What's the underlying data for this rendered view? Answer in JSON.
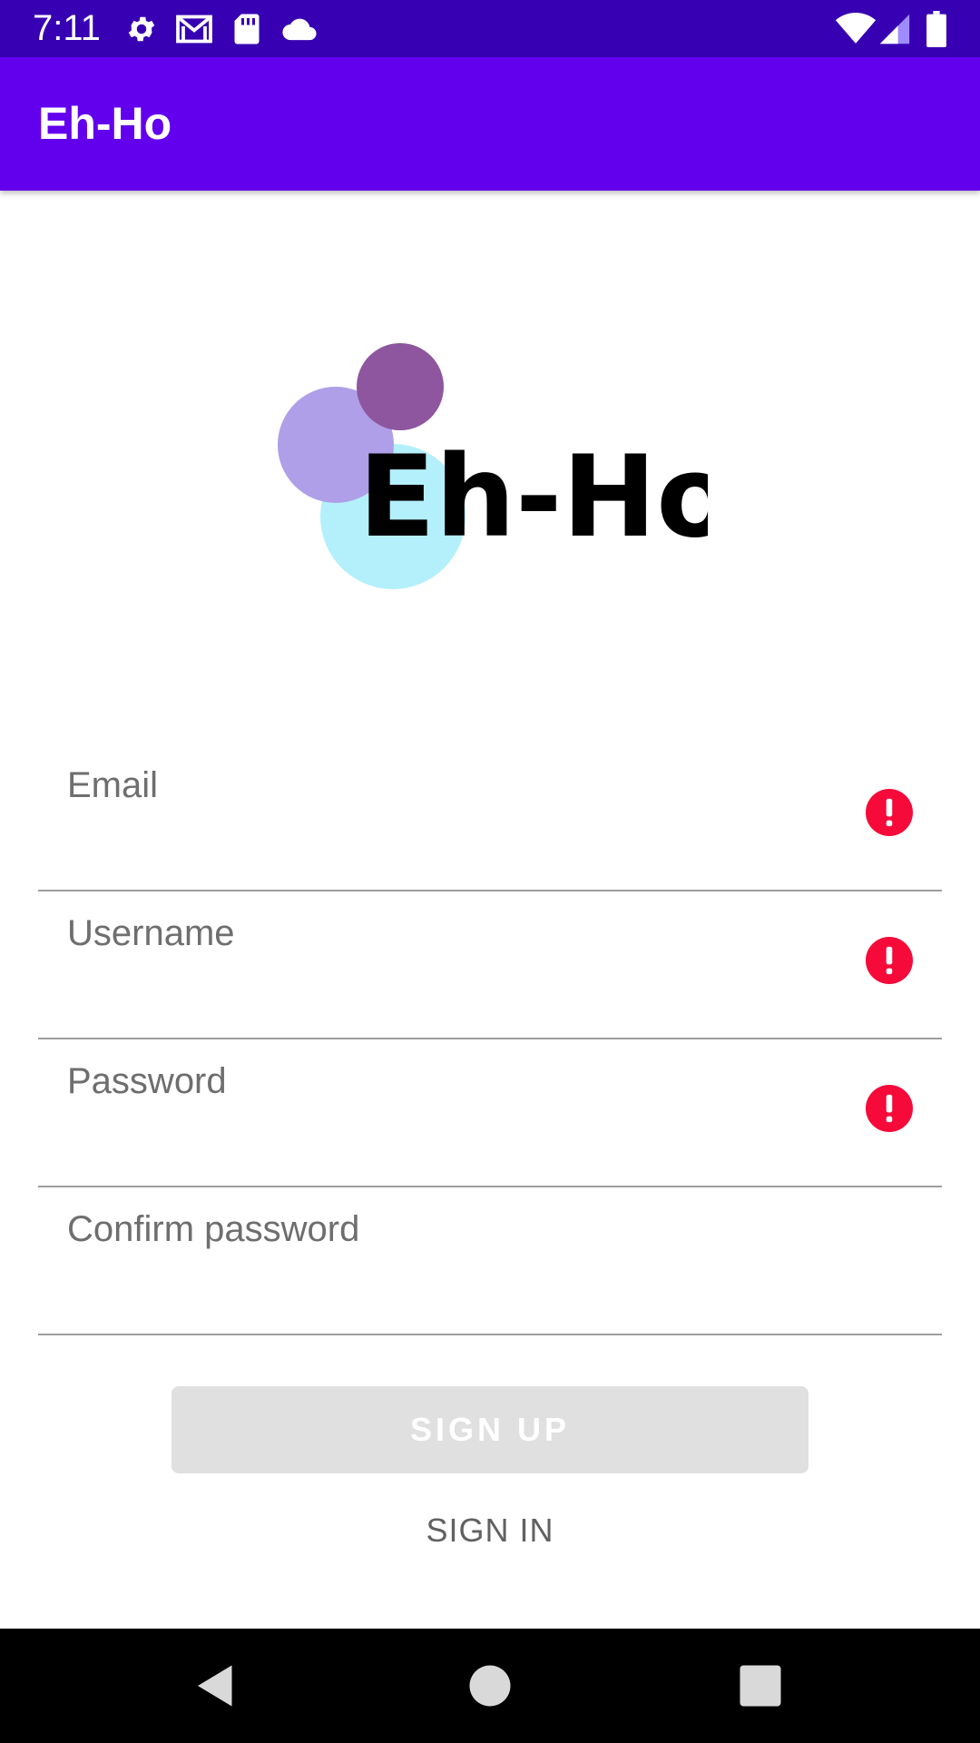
{
  "status_bar": {
    "time": "7:11",
    "left_icons": [
      "gear-icon",
      "gmail-icon",
      "sd-card-icon",
      "cloud-icon"
    ],
    "right_icons": [
      "wifi-icon",
      "signal-icon",
      "battery-icon"
    ],
    "background": "#3700b3"
  },
  "app_bar": {
    "title": "Eh-Ho",
    "background": "#6200ee"
  },
  "logo": {
    "text": "Eh-Ho",
    "circle_colors": [
      "#b3f0fb",
      "#ae9fe8",
      "#8e569f"
    ]
  },
  "form": {
    "fields": [
      {
        "label": "Email",
        "value": "",
        "has_error": true
      },
      {
        "label": "Username",
        "value": "",
        "has_error": true
      },
      {
        "label": "Password",
        "value": "",
        "has_error": true
      },
      {
        "label": "Confirm password",
        "value": "",
        "has_error": false
      }
    ],
    "error_color": "#f50a3a"
  },
  "actions": {
    "signup_label": "SIGN UP",
    "signin_label": "SIGN IN"
  },
  "nav_bar": {
    "buttons": [
      "back-icon",
      "home-icon",
      "recents-icon"
    ]
  }
}
